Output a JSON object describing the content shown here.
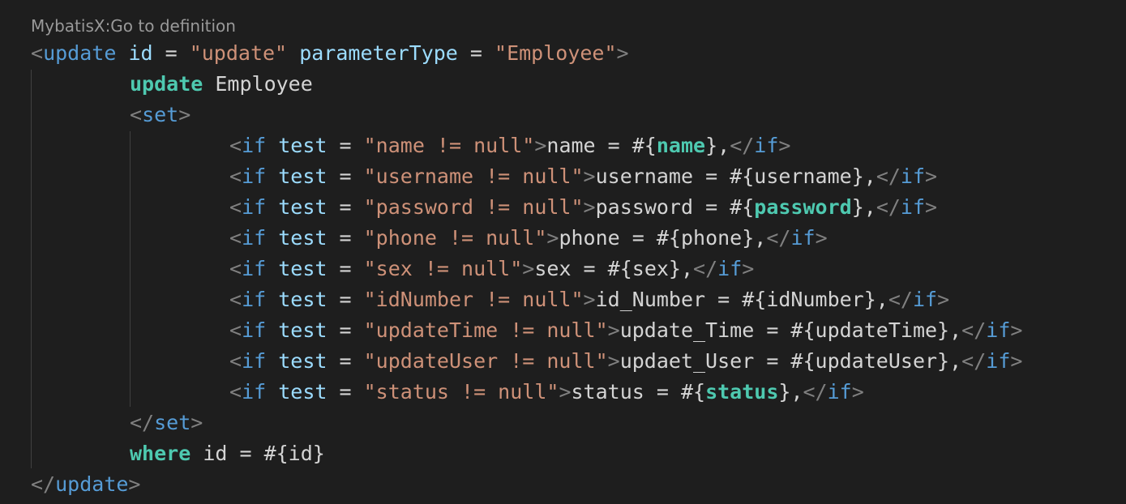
{
  "codelens": {
    "label": "MybatisX:Go to definition"
  },
  "code": {
    "open_update": {
      "tag": "update",
      "attr_id": "id",
      "eq1": " = ",
      "val_id": "\"update\"",
      "attr_param": "parameterType",
      "eq2": " = ",
      "val_param": "\"Employee\""
    },
    "update_kw": "update",
    "update_table": " Employee",
    "open_set_tag": "set",
    "if_lines": [
      {
        "test": "\"name != null\"",
        "pre": "name = #{",
        "field": "name",
        "bold": true
      },
      {
        "test": "\"username != null\"",
        "pre": "username = #{",
        "field": "username",
        "bold": false
      },
      {
        "test": "\"password != null\"",
        "pre": "password = #{",
        "field": "password",
        "bold": true
      },
      {
        "test": "\"phone != null\"",
        "pre": "phone = #{",
        "field": "phone",
        "bold": false
      },
      {
        "test": "\"sex != null\"",
        "pre": "sex = #{",
        "field": "sex",
        "bold": false
      },
      {
        "test": "\"idNumber != null\"",
        "pre": "id_Number = #{",
        "field": "idNumber",
        "bold": false
      },
      {
        "test": "\"updateTime != null\"",
        "pre": "update_Time = #{",
        "field": "updateTime",
        "bold": false
      },
      {
        "test": "\"updateUser != null\"",
        "pre": "updaet_User = #{",
        "field": "updateUser",
        "bold": false
      },
      {
        "test": "\"status != null\"",
        "pre": "status = #{",
        "field": "status",
        "bold": true
      }
    ],
    "if_tag": "if",
    "test_attr": "test",
    "eq": " = ",
    "close_suffix": "},",
    "close_set_tag": "set",
    "where_kw": "where",
    "where_rest": " id = #{id}",
    "close_update_tag": "update"
  },
  "colors": {
    "background": "#1e1e1e",
    "bracket": "#808080",
    "tag": "#569cd6",
    "attribute": "#9cdcfe",
    "string": "#ce9178",
    "text": "#d4d4d4",
    "keyword": "#4ec9b0",
    "codelens": "#999999"
  }
}
